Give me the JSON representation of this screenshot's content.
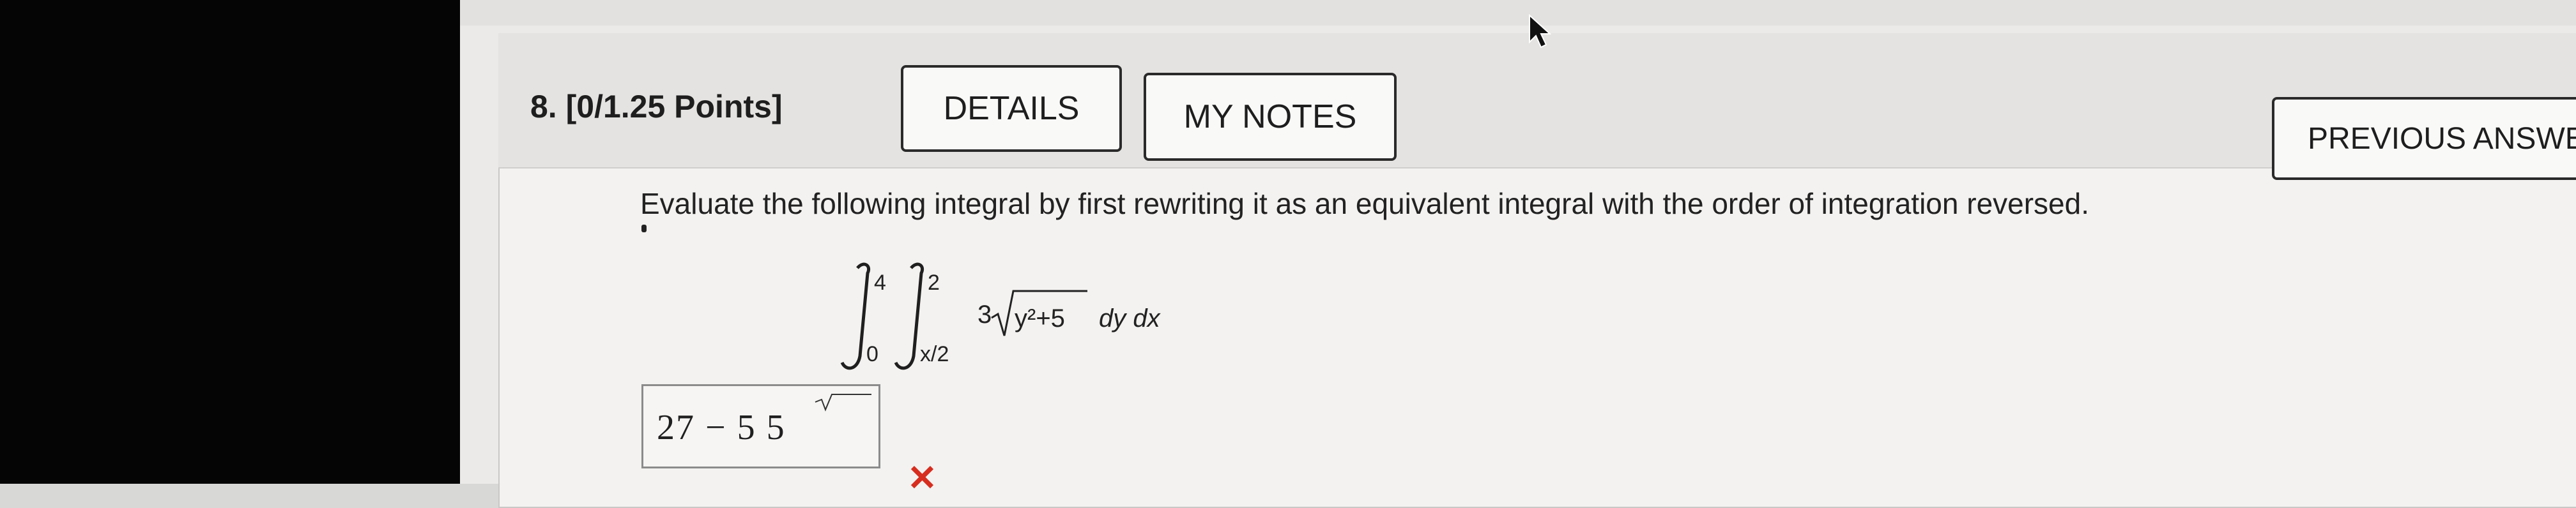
{
  "question": {
    "number": "8.",
    "points": "[0/1.25 Points]"
  },
  "toolbar": {
    "details_label": "DETAILS",
    "notes_label": "MY NOTES",
    "previous_label": "PREVIOUS ANSWE"
  },
  "prompt": "Evaluate the following integral by first rewriting it as an equivalent integral with the order of integration reversed.",
  "math": {
    "outer_upper": "4",
    "outer_lower": "0",
    "inner_upper": "2",
    "inner_lower": "x/2",
    "coefficient": "3",
    "radicand": "y²+5",
    "differentials": "dy dx"
  },
  "answer": {
    "text": "27 − 5 5",
    "status_icon": "✕"
  },
  "icons": {
    "cursor": "arrow-cursor-icon",
    "wrong": "x-mark-icon"
  },
  "colors": {
    "wrong": "#d62d1f",
    "button_border": "#2a2a2a",
    "panel": "#f3f2f0",
    "header": "#e4e3e1"
  }
}
